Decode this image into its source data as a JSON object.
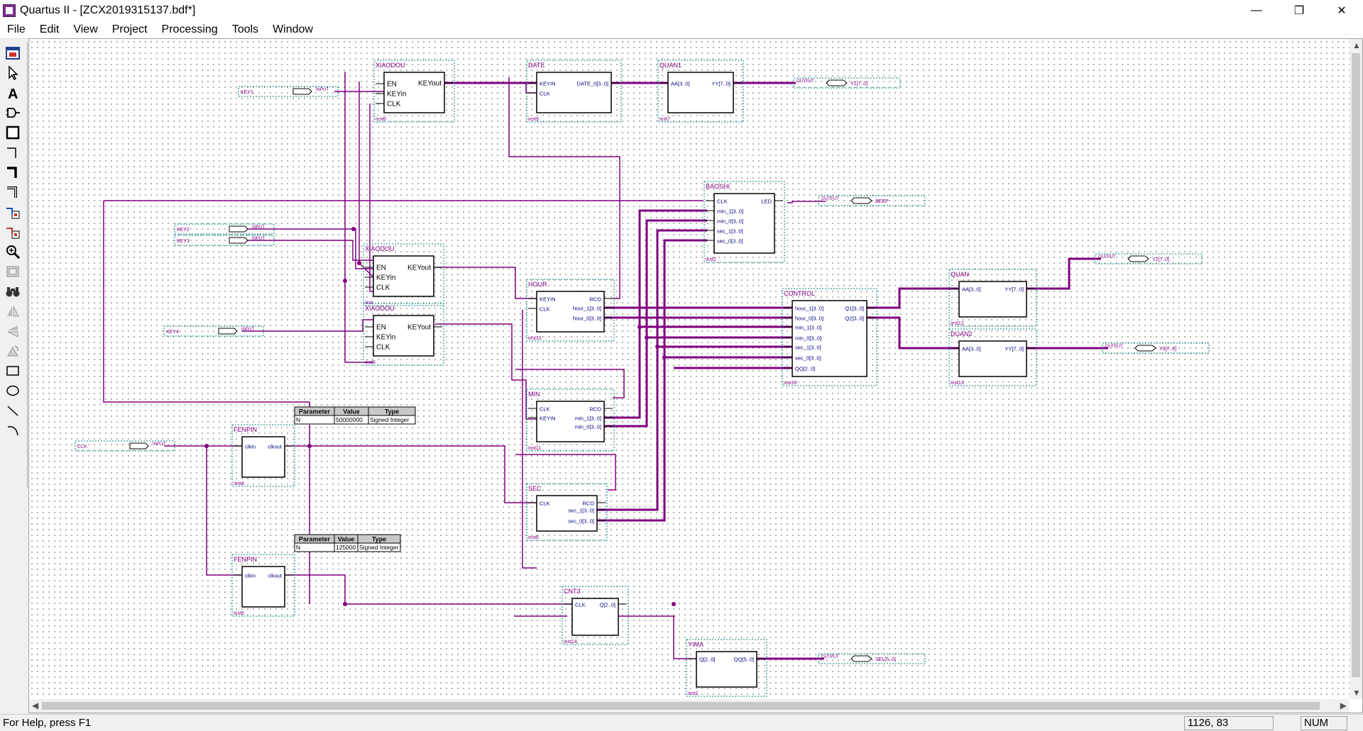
{
  "window": {
    "title": "Quartus II - [ZCX2019315137.bdf*]",
    "minimize": "—",
    "restore": "❐",
    "close": "✕"
  },
  "menu": [
    "File",
    "Edit",
    "View",
    "Project",
    "Processing",
    "Tools",
    "Window"
  ],
  "tools": [
    "floating-window-icon",
    "selection-tool-icon",
    "text-tool-icon",
    "symbol-tool-icon",
    "block-tool-icon",
    "orthogonal-node-tool-icon",
    "orthogonal-bus-tool-icon",
    "orthogonal-conduit-tool-icon",
    "rubberbanding-icon",
    "partial-line-selection-icon",
    "zoom-tool-icon",
    "full-screen-icon",
    "find-icon",
    "flip-horizontal-icon",
    "flip-vertical-icon",
    "rotate-icon",
    "rectangle-tool-icon",
    "oval-tool-icon",
    "line-tool-icon",
    "arc-tool-icon"
  ],
  "schematic": {
    "blocks": [
      {
        "id": "xiaodou1",
        "name": "XIAODOU",
        "inst": "inst6",
        "ports_left": [
          "EN",
          "KEYin",
          "CLK"
        ],
        "ports_right": [
          "KEYout"
        ]
      },
      {
        "id": "date",
        "name": "DATE",
        "inst": "inst9",
        "ports_left": [
          "KEYIN",
          "CLK"
        ],
        "ports_right": [
          "DATE_0[3..0]"
        ]
      },
      {
        "id": "quan1",
        "name": "QUAN1",
        "inst": "inst7",
        "ports_left": [
          "AA[3..0]"
        ],
        "ports_right": [
          "YY[7..0]"
        ]
      },
      {
        "id": "baoshi",
        "name": "BAOSHI",
        "inst": "inst2",
        "ports_left": [
          "CLK",
          "min_1[3..0]",
          "min_0[3..0]",
          "sec_1[3..0]",
          "sec_0[3..0]"
        ],
        "ports_right": [
          "LED"
        ]
      },
      {
        "id": "xiaodou2",
        "name": "XIAODOU",
        "inst": "inst",
        "ports_left": [
          "EN",
          "KEYin",
          "CLK"
        ],
        "ports_right": [
          "KEYout"
        ]
      },
      {
        "id": "xiaodou3",
        "name": "XIAODOU",
        "inst": "inst3",
        "ports_left": [
          "EN",
          "KEYin",
          "CLK"
        ],
        "ports_right": [
          "KEYout"
        ]
      },
      {
        "id": "hour",
        "name": "HOUR",
        "inst": "inst10",
        "ports_left": [
          "KEYIN",
          "CLK"
        ],
        "ports_right": [
          "RCO",
          "hour_1[3..0]",
          "hour_0[3..0]"
        ]
      },
      {
        "id": "control",
        "name": "CONTROL",
        "inst": "inst16",
        "ports_left": [
          "hour_1[3..0]",
          "hour_0[3..0]",
          "min_1[3..0]",
          "min_0[3..0]",
          "sec_1[3..0]",
          "sec_0[3..0]",
          "QQ[2..0]"
        ],
        "ports_right": [
          "Q1[3..0]",
          "Q2[3..0]"
        ]
      },
      {
        "id": "quan",
        "name": "QUAN",
        "inst": "inst12",
        "ports_left": [
          "AA[3..0]"
        ],
        "ports_right": [
          "YY[7..0]"
        ]
      },
      {
        "id": "duan2",
        "name": "DUAN2",
        "inst": "inst13",
        "ports_left": [
          "AA[3..0]"
        ],
        "ports_right": [
          "YY[7..0]"
        ]
      },
      {
        "id": "min",
        "name": "MIN",
        "inst": "inst11",
        "ports_left": [
          "CLK",
          "KEYIN"
        ],
        "ports_right": [
          "RCO",
          "min_1[3..0]",
          "min_0[3..0]"
        ]
      },
      {
        "id": "fdiv50m",
        "name": "FENPIN",
        "inst": "inst4",
        "ports_left": [
          "clkin"
        ],
        "ports_right": [
          "clkout"
        ]
      },
      {
        "id": "sec",
        "name": "SEC",
        "inst": "inst8",
        "ports_left": [
          "CLK"
        ],
        "ports_right": [
          "RCO",
          "sec_1[3..0]",
          "sec_0[3..0]"
        ]
      },
      {
        "id": "fdiv2",
        "name": "FENPIN",
        "inst": "inst5",
        "ports_left": [
          "clkin"
        ],
        "ports_right": [
          "clkout"
        ]
      },
      {
        "id": "cnt3",
        "name": "CNT3",
        "inst": "inst14",
        "ports_left": [
          "CLK"
        ],
        "ports_right": [
          "Q[2..0]"
        ]
      },
      {
        "id": "yima",
        "name": "YIMA",
        "inst": "inst1",
        "ports_left": [
          "Q[2..0]"
        ],
        "ports_right": [
          "QQ[5..0]"
        ]
      }
    ],
    "param_tables": [
      {
        "headers": [
          "Parameter",
          "Value",
          "Type"
        ],
        "row": [
          "N",
          "50000000",
          "Signed Integer"
        ]
      },
      {
        "headers": [
          "Parameter",
          "Value",
          "Type"
        ],
        "row": [
          "N",
          "125000",
          "Signed Integer"
        ]
      }
    ],
    "pins": [
      {
        "kind": "INPUT",
        "label": "KEY1"
      },
      {
        "kind": "INPUT",
        "label": "KEY2"
      },
      {
        "kind": "INPUT",
        "label": "KEY3"
      },
      {
        "kind": "INPUT",
        "label": "KEY4"
      },
      {
        "kind": "INPUT",
        "label": "CLK"
      },
      {
        "kind": "OUTPUT",
        "label": "Y1[7..0]"
      },
      {
        "kind": "OUTPUT",
        "label": "BEEP"
      },
      {
        "kind": "OUTPUT",
        "label": "Y2[7..0]"
      },
      {
        "kind": "OUTPUT",
        "label": "Y3[7..0]"
      },
      {
        "kind": "OUTPUT",
        "label": "SEL[5..0]"
      }
    ]
  },
  "status": {
    "help": "For Help, press F1",
    "coords": "1126, 83",
    "num": "NUM"
  },
  "colors": {
    "wire": "#800080",
    "block_label": "#800080",
    "port_text": "#000080",
    "frame": "#008080"
  }
}
